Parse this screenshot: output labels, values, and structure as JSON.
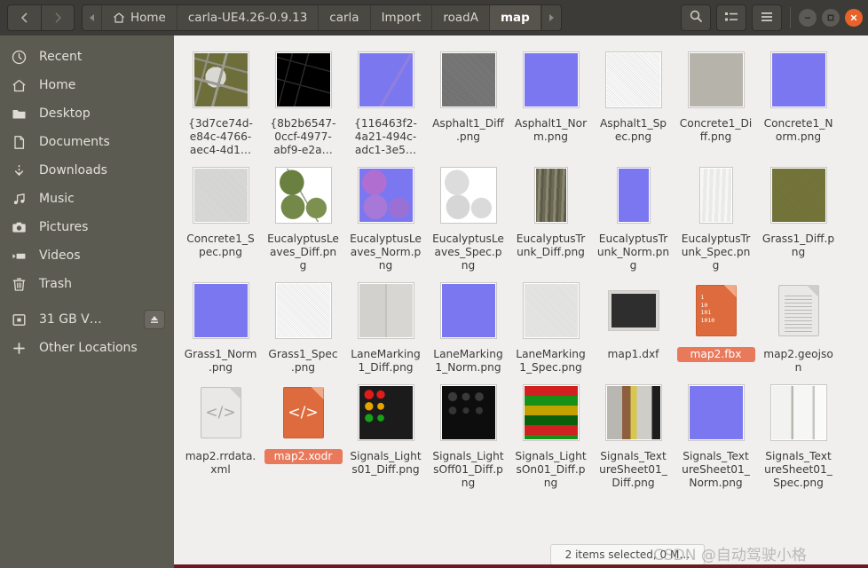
{
  "window": {
    "title": "map",
    "controls": {
      "minimize": "–",
      "maximize": "□",
      "close": "✕"
    }
  },
  "header": {
    "back_label": "‹",
    "forward_label": "›",
    "crumb_scroll_left": "◀",
    "crumb_scroll_right": "▶",
    "breadcrumbs": [
      {
        "label": "Home",
        "icon": "home-icon",
        "active": false
      },
      {
        "label": "carla-UE4.26-0.9.13",
        "active": false
      },
      {
        "label": "carla",
        "active": false
      },
      {
        "label": "Import",
        "active": false
      },
      {
        "label": "roadA",
        "active": false
      },
      {
        "label": "map",
        "active": true
      }
    ],
    "tools": [
      {
        "name": "search-icon",
        "label": "Search"
      },
      {
        "name": "view-options-icon",
        "label": "View options"
      },
      {
        "name": "menu-icon",
        "label": "Menu"
      }
    ]
  },
  "sidebar": {
    "items": [
      {
        "label": "Recent",
        "icon": "clock-icon"
      },
      {
        "label": "Home",
        "icon": "home-icon"
      },
      {
        "label": "Desktop",
        "icon": "folder-icon"
      },
      {
        "label": "Documents",
        "icon": "document-icon"
      },
      {
        "label": "Downloads",
        "icon": "download-icon"
      },
      {
        "label": "Music",
        "icon": "music-icon"
      },
      {
        "label": "Pictures",
        "icon": "camera-icon"
      },
      {
        "label": "Videos",
        "icon": "video-icon"
      },
      {
        "label": "Trash",
        "icon": "trash-icon"
      }
    ],
    "devices": [
      {
        "label": "31 GB V…",
        "icon": "drive-icon",
        "eject": "⏏"
      }
    ],
    "other": {
      "label": "Other Locations",
      "icon": "plus-icon"
    }
  },
  "files": [
    {
      "name": "{3d7ce74d-e84c-4766-aec4-4d1…",
      "thumb": "t-aerial",
      "kind": "image",
      "selected": false
    },
    {
      "name": "{8b2b6547-0ccf-4977-abf9-e2a…",
      "thumb": "t-black-lines",
      "kind": "image",
      "selected": false
    },
    {
      "name": "{116463f2-4a21-494c-adc1-3e5…",
      "thumb": "t-normal-map",
      "kind": "image",
      "selected": false
    },
    {
      "name": "Asphalt1_Diff.png",
      "thumb": "t-asphalt",
      "kind": "image",
      "selected": false
    },
    {
      "name": "Asphalt1_Norm.png",
      "thumb": "t-blue",
      "kind": "image",
      "selected": false
    },
    {
      "name": "Asphalt1_Spec.png",
      "thumb": "t-white-noise",
      "kind": "image",
      "selected": false
    },
    {
      "name": "Concrete1_Diff.png",
      "thumb": "t-concrete",
      "kind": "image",
      "selected": false
    },
    {
      "name": "Concrete1_Norm.png",
      "thumb": "t-blue",
      "kind": "image",
      "selected": false
    },
    {
      "name": "Concrete1_Spec.png",
      "thumb": "t-concrete-light",
      "kind": "image",
      "selected": false
    },
    {
      "name": "EucalyptusLeaves_Diff.png",
      "thumb": "t-leaves-diff",
      "kind": "image",
      "selected": false
    },
    {
      "name": "EucalyptusLeaves_Norm.png",
      "thumb": "t-leaves-norm",
      "kind": "image",
      "selected": false
    },
    {
      "name": "EucalyptusLeaves_Spec.png",
      "thumb": "t-leaves-spec",
      "kind": "image",
      "selected": false
    },
    {
      "name": "EucalyptusTrunk_Diff.png",
      "thumb": "t-bark",
      "kind": "image",
      "tall": true,
      "selected": false
    },
    {
      "name": "EucalyptusTrunk_Norm.png",
      "thumb": "t-blue",
      "kind": "image",
      "tall": true,
      "selected": false
    },
    {
      "name": "EucalyptusTrunk_Spec.png",
      "thumb": "t-bark-spec",
      "kind": "image",
      "tall": true,
      "selected": false
    },
    {
      "name": "Grass1_Diff.png",
      "thumb": "t-grass",
      "kind": "image",
      "selected": false
    },
    {
      "name": "Grass1_Norm.png",
      "thumb": "t-blue",
      "kind": "image",
      "selected": false
    },
    {
      "name": "Grass1_Spec.png",
      "thumb": "t-white-noise",
      "kind": "image",
      "selected": false
    },
    {
      "name": "LaneMarking1_Diff.png",
      "thumb": "t-lane-diff",
      "kind": "image",
      "selected": false
    },
    {
      "name": "LaneMarking1_Norm.png",
      "thumb": "t-blue",
      "kind": "image",
      "selected": false
    },
    {
      "name": "LaneMarking1_Spec.png",
      "thumb": "t-lane-spec",
      "kind": "image",
      "selected": false
    },
    {
      "name": "map1.dxf",
      "thumb": "t-dark-box",
      "kind": "image",
      "small": true,
      "selected": false
    },
    {
      "name": "map2.fbx",
      "kind": "binary-file",
      "selected": true
    },
    {
      "name": "map2.geojson",
      "kind": "text-file",
      "selected": false
    },
    {
      "name": "map2.rrdata.xml",
      "kind": "code-file",
      "glyph": "</>",
      "selected": false
    },
    {
      "name": "map2.xodr",
      "kind": "code-file-orange",
      "glyph": "</>",
      "selected": true
    },
    {
      "name": "Signals_Lights01_Diff.png",
      "thumb": "t-signals-lights",
      "kind": "image",
      "selected": false
    },
    {
      "name": "Signals_LightsOff01_Diff.png",
      "thumb": "t-signals-off",
      "kind": "image",
      "selected": false
    },
    {
      "name": "Signals_LightsOn01_Diff.png",
      "thumb": "t-signals-on",
      "kind": "image",
      "selected": false
    },
    {
      "name": "Signals_TextureSheet01_Diff.png",
      "thumb": "t-sheet-diff",
      "kind": "image",
      "selected": false
    },
    {
      "name": "Signals_TextureSheet01_Norm.png",
      "thumb": "t-sheet-norm",
      "kind": "image",
      "selected": false
    },
    {
      "name": "Signals_TextureSheet01_Spec.png",
      "thumb": "t-sheet-spec",
      "kind": "image",
      "selected": false
    }
  ],
  "statusbar": {
    "text": "2 items selected, 0 M…"
  },
  "watermark": {
    "text": "CSDN @自动驾驶小格"
  },
  "colors": {
    "header_bg": "#3d3b37",
    "sidebar_bg": "#5c5b51",
    "content_bg": "#f0efee",
    "selection": "#e9795b",
    "close_button": "#e8622b"
  }
}
